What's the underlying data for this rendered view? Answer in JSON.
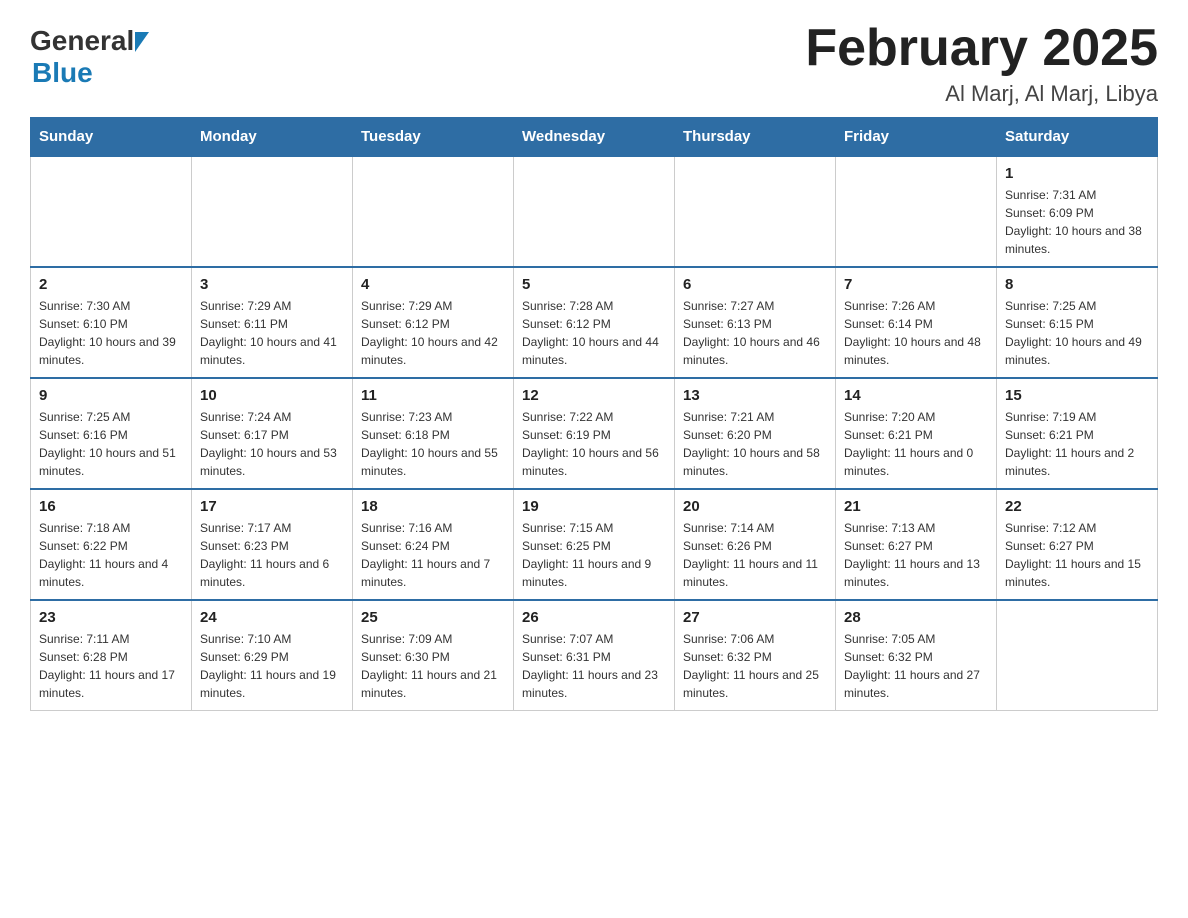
{
  "header": {
    "title": "February 2025",
    "subtitle": "Al Marj, Al Marj, Libya",
    "logo_general": "General",
    "logo_blue": "Blue"
  },
  "calendar": {
    "days_of_week": [
      "Sunday",
      "Monday",
      "Tuesday",
      "Wednesday",
      "Thursday",
      "Friday",
      "Saturday"
    ],
    "weeks": [
      {
        "days": [
          {
            "date": "",
            "info": ""
          },
          {
            "date": "",
            "info": ""
          },
          {
            "date": "",
            "info": ""
          },
          {
            "date": "",
            "info": ""
          },
          {
            "date": "",
            "info": ""
          },
          {
            "date": "",
            "info": ""
          },
          {
            "date": "1",
            "info": "Sunrise: 7:31 AM\nSunset: 6:09 PM\nDaylight: 10 hours and 38 minutes."
          }
        ]
      },
      {
        "days": [
          {
            "date": "2",
            "info": "Sunrise: 7:30 AM\nSunset: 6:10 PM\nDaylight: 10 hours and 39 minutes."
          },
          {
            "date": "3",
            "info": "Sunrise: 7:29 AM\nSunset: 6:11 PM\nDaylight: 10 hours and 41 minutes."
          },
          {
            "date": "4",
            "info": "Sunrise: 7:29 AM\nSunset: 6:12 PM\nDaylight: 10 hours and 42 minutes."
          },
          {
            "date": "5",
            "info": "Sunrise: 7:28 AM\nSunset: 6:12 PM\nDaylight: 10 hours and 44 minutes."
          },
          {
            "date": "6",
            "info": "Sunrise: 7:27 AM\nSunset: 6:13 PM\nDaylight: 10 hours and 46 minutes."
          },
          {
            "date": "7",
            "info": "Sunrise: 7:26 AM\nSunset: 6:14 PM\nDaylight: 10 hours and 48 minutes."
          },
          {
            "date": "8",
            "info": "Sunrise: 7:25 AM\nSunset: 6:15 PM\nDaylight: 10 hours and 49 minutes."
          }
        ]
      },
      {
        "days": [
          {
            "date": "9",
            "info": "Sunrise: 7:25 AM\nSunset: 6:16 PM\nDaylight: 10 hours and 51 minutes."
          },
          {
            "date": "10",
            "info": "Sunrise: 7:24 AM\nSunset: 6:17 PM\nDaylight: 10 hours and 53 minutes."
          },
          {
            "date": "11",
            "info": "Sunrise: 7:23 AM\nSunset: 6:18 PM\nDaylight: 10 hours and 55 minutes."
          },
          {
            "date": "12",
            "info": "Sunrise: 7:22 AM\nSunset: 6:19 PM\nDaylight: 10 hours and 56 minutes."
          },
          {
            "date": "13",
            "info": "Sunrise: 7:21 AM\nSunset: 6:20 PM\nDaylight: 10 hours and 58 minutes."
          },
          {
            "date": "14",
            "info": "Sunrise: 7:20 AM\nSunset: 6:21 PM\nDaylight: 11 hours and 0 minutes."
          },
          {
            "date": "15",
            "info": "Sunrise: 7:19 AM\nSunset: 6:21 PM\nDaylight: 11 hours and 2 minutes."
          }
        ]
      },
      {
        "days": [
          {
            "date": "16",
            "info": "Sunrise: 7:18 AM\nSunset: 6:22 PM\nDaylight: 11 hours and 4 minutes."
          },
          {
            "date": "17",
            "info": "Sunrise: 7:17 AM\nSunset: 6:23 PM\nDaylight: 11 hours and 6 minutes."
          },
          {
            "date": "18",
            "info": "Sunrise: 7:16 AM\nSunset: 6:24 PM\nDaylight: 11 hours and 7 minutes."
          },
          {
            "date": "19",
            "info": "Sunrise: 7:15 AM\nSunset: 6:25 PM\nDaylight: 11 hours and 9 minutes."
          },
          {
            "date": "20",
            "info": "Sunrise: 7:14 AM\nSunset: 6:26 PM\nDaylight: 11 hours and 11 minutes."
          },
          {
            "date": "21",
            "info": "Sunrise: 7:13 AM\nSunset: 6:27 PM\nDaylight: 11 hours and 13 minutes."
          },
          {
            "date": "22",
            "info": "Sunrise: 7:12 AM\nSunset: 6:27 PM\nDaylight: 11 hours and 15 minutes."
          }
        ]
      },
      {
        "days": [
          {
            "date": "23",
            "info": "Sunrise: 7:11 AM\nSunset: 6:28 PM\nDaylight: 11 hours and 17 minutes."
          },
          {
            "date": "24",
            "info": "Sunrise: 7:10 AM\nSunset: 6:29 PM\nDaylight: 11 hours and 19 minutes."
          },
          {
            "date": "25",
            "info": "Sunrise: 7:09 AM\nSunset: 6:30 PM\nDaylight: 11 hours and 21 minutes."
          },
          {
            "date": "26",
            "info": "Sunrise: 7:07 AM\nSunset: 6:31 PM\nDaylight: 11 hours and 23 minutes."
          },
          {
            "date": "27",
            "info": "Sunrise: 7:06 AM\nSunset: 6:32 PM\nDaylight: 11 hours and 25 minutes."
          },
          {
            "date": "28",
            "info": "Sunrise: 7:05 AM\nSunset: 6:32 PM\nDaylight: 11 hours and 27 minutes."
          },
          {
            "date": "",
            "info": ""
          }
        ]
      }
    ]
  }
}
